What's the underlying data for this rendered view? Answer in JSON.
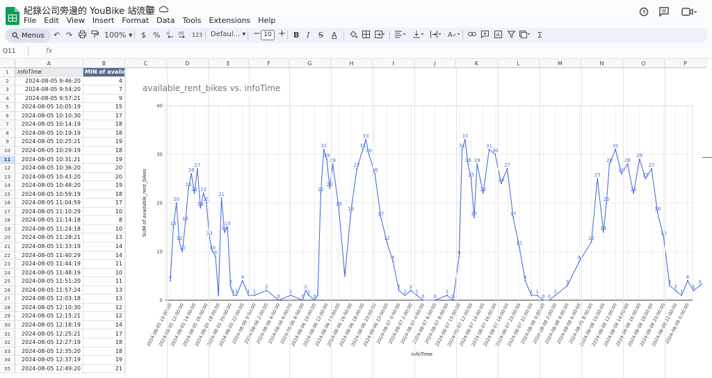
{
  "doc": {
    "title": "紀錄公司旁邊的 YouBike 站流量"
  },
  "menu": [
    "File",
    "Edit",
    "View",
    "Insert",
    "Format",
    "Data",
    "Tools",
    "Extensions",
    "Help"
  ],
  "toolbar": {
    "menus_label": "Menus",
    "zoom": "100%",
    "currency": "$",
    "percent": "%",
    "dec_less": ".0",
    "dec_more": ".00",
    "number_format": "123",
    "font": "Defaul...",
    "font_size": "10"
  },
  "formula": {
    "name_box": "Q11",
    "fx": "fx"
  },
  "columns": [
    "A",
    "B",
    "C",
    "D",
    "E",
    "F",
    "G",
    "H",
    "I",
    "J",
    "K",
    "L",
    "M",
    "N",
    "O",
    "P"
  ],
  "sheet": {
    "header": [
      "infoTime",
      "MIN of available"
    ],
    "rows": [
      [
        "2024-08-05 9:46:20",
        "4"
      ],
      [
        "2024-08-05 9:54:20",
        "7"
      ],
      [
        "2024-08-05 9:57:21",
        "9"
      ],
      [
        "2024-08-05 10:05:19",
        "15"
      ],
      [
        "2024-08-05 10:10:30",
        "17"
      ],
      [
        "2024-08-05 10:14:19",
        "18"
      ],
      [
        "2024-08-05 10:19:19",
        "18"
      ],
      [
        "2024-08-05 10:25:21",
        "19"
      ],
      [
        "2024-08-05 10:29:19",
        "18"
      ],
      [
        "2024-08-05 10:31:21",
        "19"
      ],
      [
        "2024-08-05 10:36:20",
        "20"
      ],
      [
        "2024-08-05 10:43:20",
        "20"
      ],
      [
        "2024-08-05 10:48:20",
        "19"
      ],
      [
        "2024-08-05 10:59:19",
        "18"
      ],
      [
        "2024-08-05 11:04:59",
        "17"
      ],
      [
        "2024-08-05 11:10:29",
        "10"
      ],
      [
        "2024-08-05 11:14:18",
        "8"
      ],
      [
        "2024-08-05 11:24:18",
        "10"
      ],
      [
        "2024-08-05 11:28:21",
        "13"
      ],
      [
        "2024-08-05 11:33:19",
        "14"
      ],
      [
        "2024-08-05 11:40:29",
        "14"
      ],
      [
        "2024-08-05 11:44:19",
        "11"
      ],
      [
        "2024-08-05 11:48:19",
        "10"
      ],
      [
        "2024-08-05 11:51:20",
        "11"
      ],
      [
        "2024-08-05 11:57:24",
        "13"
      ],
      [
        "2024-08-05 12:03:18",
        "13"
      ],
      [
        "2024-08-05 12:10:30",
        "12"
      ],
      [
        "2024-08-05 12:15:21",
        "12"
      ],
      [
        "2024-08-05 12:18:19",
        "14"
      ],
      [
        "2024-08-05 12:25:21",
        "17"
      ],
      [
        "2024-08-05 12:27:19",
        "18"
      ],
      [
        "2024-08-05 12:35:20",
        "18"
      ],
      [
        "2024-08-05 12:37:19",
        "19"
      ],
      [
        "2024-08-05 12:49:20",
        "21"
      ]
    ]
  },
  "chart_data": {
    "type": "line",
    "title": "available_rent_bikes vs. infoTime",
    "xlabel": "infoTime",
    "ylabel": "SUM of available_rent_bikes",
    "ylim": [
      0,
      40
    ],
    "yticks": [
      0,
      10,
      20,
      30,
      40
    ],
    "grid": true,
    "xticks": [
      "2024-08-05 10:00:00",
      "2024-08-05 12:00:00",
      "2024-08-05 14:00:00",
      "2024-08-05 16:00:00",
      "2024-08-05 18:00:00",
      "2024-08-05 20:00:00",
      "2024-08-05 22:00:00",
      "2024-08-06 0:00:00",
      "2024-08-06 2:00:00",
      "2024-08-06 4:00:00",
      "2024-08-06 6:00:00",
      "2024-08-06 8:00:00",
      "2024-08-06 10:00:00",
      "2024-08-06 12:00:00",
      "2024-08-06 14:00:00",
      "2024-08-06 16:00:00",
      "2024-08-06 18:00:00",
      "2024-08-06 20:00:00",
      "2024-08-06 22:00:00",
      "2024-08-07 0:00:00",
      "2024-08-07 2:00:00",
      "2024-08-07 4:00:00",
      "2024-08-07 6:00:00",
      "2024-08-07 8:00:00",
      "2024-08-07 10:00:00",
      "2024-08-07 12:00:00",
      "2024-08-07 14:00:00",
      "2024-08-07 16:00:00",
      "2024-08-07 18:00:00",
      "2024-08-07 20:00:00",
      "2024-08-07 22:00:00",
      "2024-08-08 0:00:00",
      "2024-08-08 2:00:00",
      "2024-08-08 4:00:00",
      "2024-08-08 6:00:00",
      "2024-08-08 8:00:00",
      "2024-08-08 10:00:00",
      "2024-08-08 12:00:00",
      "2024-08-08 14:00:00",
      "2024-08-08 16:00:00",
      "2024-08-08 18:00:00",
      "2024-08-08 20:00:00",
      "2024-08-08 22:00:00",
      "2024-08-09 0:00:00"
    ],
    "x_hours": [
      0,
      0.5,
      1,
      1.5,
      2,
      2.5,
      3,
      3.5,
      4,
      4.5,
      5,
      5.5,
      6,
      6.5,
      7,
      7.5,
      8,
      8.5,
      9,
      9.5,
      10,
      10.5,
      11,
      12,
      13,
      14,
      16,
      18,
      20,
      22,
      22.5,
      23,
      24,
      24.5,
      25,
      25.5,
      26,
      26.5,
      27,
      28,
      29,
      30,
      31,
      32,
      32.5,
      33,
      34,
      35,
      36,
      37,
      38,
      39,
      40,
      41,
      42,
      44,
      46,
      47,
      48,
      48.5,
      49,
      49.5,
      50,
      50.5,
      51,
      52,
      53,
      54,
      55,
      56,
      57,
      58,
      59,
      60,
      61,
      62,
      63,
      64,
      66,
      68,
      70,
      71,
      72,
      72.5,
      73,
      74,
      75,
      76,
      77,
      78,
      79,
      80,
      81,
      82,
      83,
      84,
      85,
      86,
      87,
      88,
      89,
      90,
      91
    ],
    "values": [
      4,
      15,
      20,
      12,
      10,
      16,
      23,
      26,
      22,
      27,
      19,
      22,
      20,
      13,
      10,
      9,
      1,
      21,
      14,
      15,
      3,
      1,
      1,
      4,
      1,
      1,
      2,
      0,
      1,
      0,
      2,
      1,
      0,
      1,
      22,
      31,
      29,
      23,
      28,
      19,
      5,
      18,
      27,
      31,
      33,
      30,
      26,
      17,
      12,
      8,
      2,
      1,
      2,
      1,
      0,
      0,
      1,
      0,
      9,
      31,
      33,
      28,
      25,
      17,
      28,
      22,
      31,
      30,
      24,
      27,
      17,
      11,
      4,
      1,
      1,
      0,
      0,
      1,
      3,
      8,
      12,
      25,
      14,
      20,
      28,
      31,
      26,
      28,
      22,
      29,
      25,
      27,
      18,
      13,
      3,
      2,
      1,
      4,
      2,
      3,
      4
    ]
  }
}
